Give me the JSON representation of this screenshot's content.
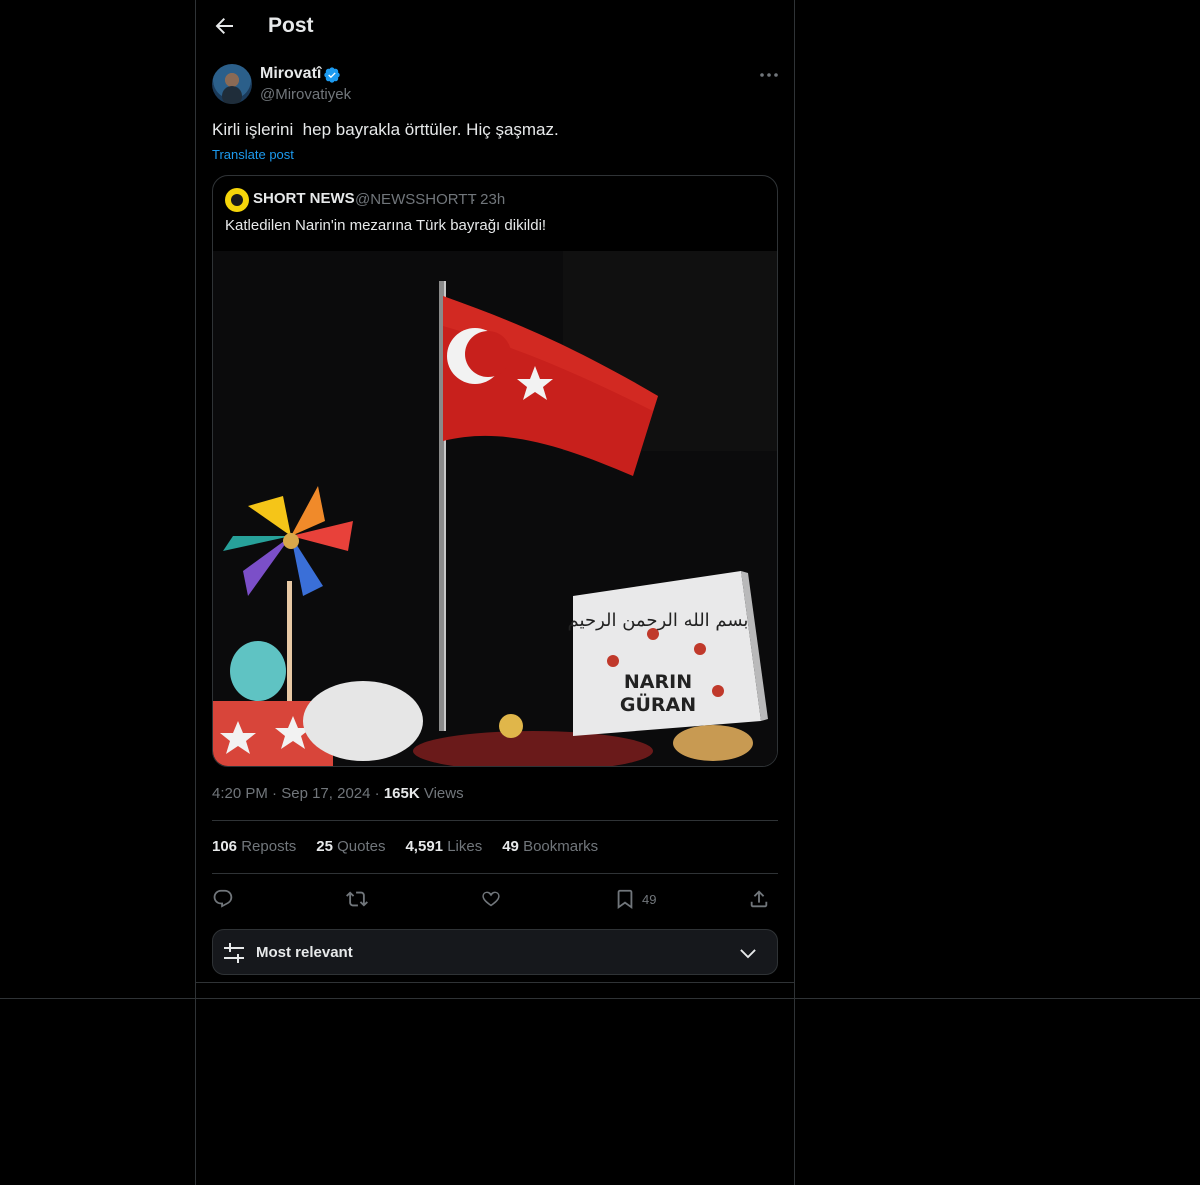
{
  "header": {
    "title": "Post"
  },
  "author": {
    "name": "Mirovatî",
    "handle": "@Mirovatiyek"
  },
  "post": {
    "text": "Kirli işlerini  hep bayrakla örttüler. Hiç şaşmaz.",
    "translate_label": "Translate post"
  },
  "quote": {
    "name": "SHORT NEWS",
    "handle": "@NEWSSHORTT",
    "time": "· 23h",
    "text": "Katledilen Narin'in mezarına Türk bayrağı dikildi!",
    "image": {
      "gravestone_line1": "NARIN",
      "gravestone_line2": "GÜRAN",
      "inscription": "بسم الله الرحمن الرحيم"
    }
  },
  "meta": {
    "time": "4:20 PM",
    "sep": "·",
    "date": "Sep 17, 2024",
    "sep2": "·",
    "views_count": "165K",
    "views_label": "Views"
  },
  "stats": {
    "reposts_count": "106",
    "reposts_label": "Reposts",
    "quotes_count": "25",
    "quotes_label": "Quotes",
    "likes_count": "4,591",
    "likes_label": "Likes",
    "bookmarks_count": "49",
    "bookmarks_label": "Bookmarks"
  },
  "actions": {
    "bookmark_count": "49"
  },
  "sort": {
    "label": "Most relevant"
  },
  "colors": {
    "accent": "#1d9bf0",
    "muted": "#71767b",
    "border": "#2f3336",
    "text": "#e7e9ea"
  }
}
